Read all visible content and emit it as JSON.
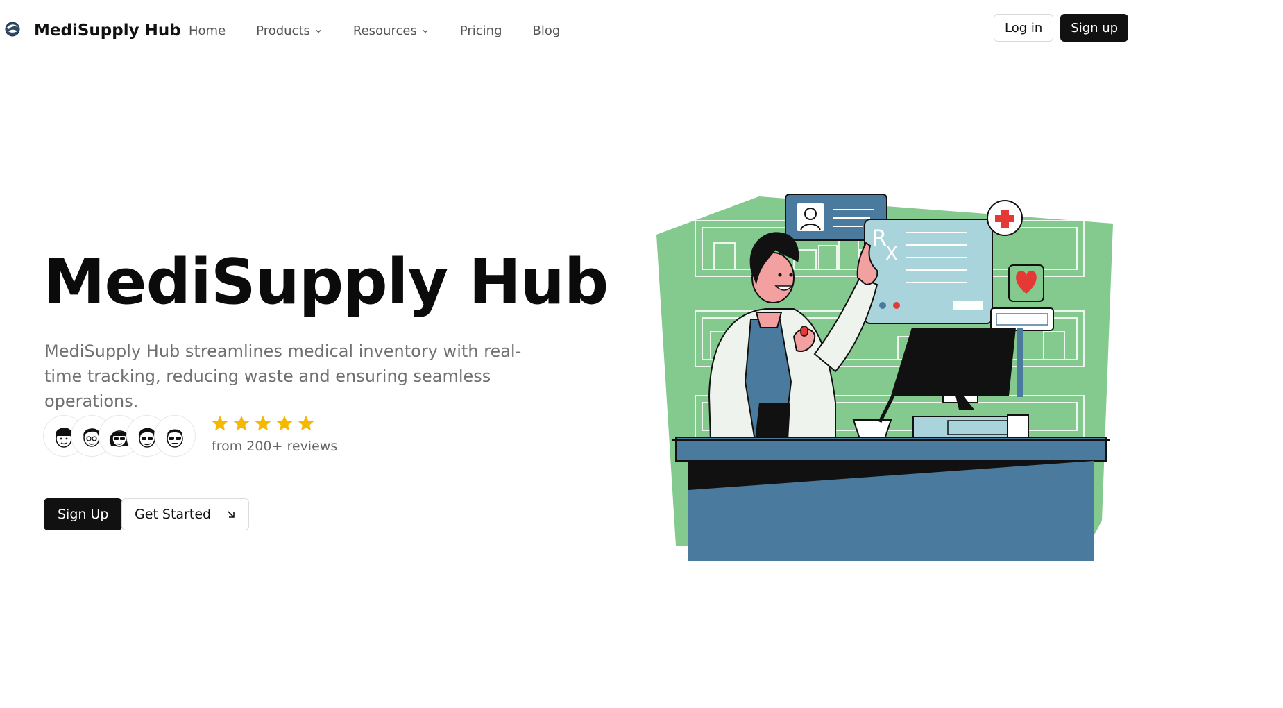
{
  "nav": {
    "brand": "MediSupply Hub",
    "logo_icon": "globe-swirl-icon",
    "links": [
      {
        "label": "Home",
        "has_dropdown": false
      },
      {
        "label": "Products",
        "has_dropdown": true
      },
      {
        "label": "Resources",
        "has_dropdown": true
      },
      {
        "label": "Pricing",
        "has_dropdown": false
      },
      {
        "label": "Blog",
        "has_dropdown": false
      }
    ],
    "login_label": "Log in",
    "signup_label": "Sign up"
  },
  "hero": {
    "title": "MediSupply Hub",
    "description": "MediSupply Hub streamlines medical inventory with real-time tracking, reducing waste and ensuring seamless operations.",
    "rating": {
      "stars": 5,
      "reviews_text": "from 200+ reviews",
      "star_color": "#F5B800"
    },
    "avatars_count": 5,
    "primary_cta": "Sign Up",
    "secondary_cta": "Get Started",
    "secondary_cta_icon": "arrow-down-right-icon"
  },
  "illustration": {
    "rx_label": "R",
    "rx_sub": "X",
    "colors": {
      "green": "#84C98E",
      "blue": "#4A7A9E",
      "light_blue": "#A9D4DC",
      "red": "#E53935",
      "black": "#111111"
    }
  }
}
